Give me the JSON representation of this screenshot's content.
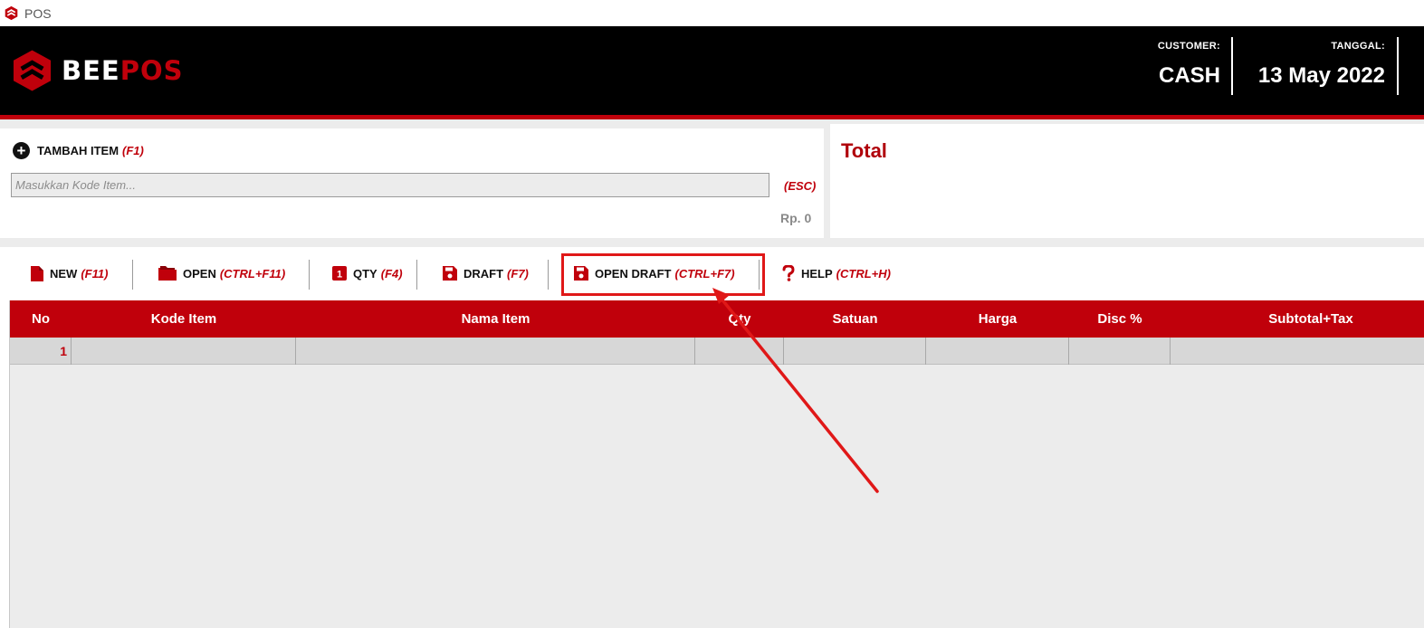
{
  "window": {
    "title": "POS"
  },
  "brand": {
    "bee": "BEE",
    "pos": "POS"
  },
  "header": {
    "customer_label": "CUSTOMER:",
    "customer_value": "CASH",
    "date_label": "TANGGAL:",
    "date_value": "13 May 2022"
  },
  "add_item": {
    "label": "TAMBAH ITEM",
    "shortcut": "(F1)",
    "placeholder": "Masukkan Kode Item...",
    "esc_shortcut": "(ESC)",
    "amount": "Rp. 0"
  },
  "total": {
    "label": "Total"
  },
  "toolbar": {
    "buttons": [
      {
        "label": "NEW",
        "shortcut": "(F11)",
        "icon": "file-icon"
      },
      {
        "label": "OPEN",
        "shortcut": "(CTRL+F11)",
        "icon": "folder-icon"
      },
      {
        "label": "QTY",
        "shortcut": "(F4)",
        "icon": "qty-icon"
      },
      {
        "label": "DRAFT",
        "shortcut": "(F7)",
        "icon": "save-icon"
      },
      {
        "label": "OPEN DRAFT",
        "shortcut": "(CTRL+F7)",
        "icon": "save-icon"
      },
      {
        "label": "HELP",
        "shortcut": "(CTRL+H)",
        "icon": "question-icon"
      }
    ]
  },
  "grid": {
    "columns": [
      "No",
      "Kode Item",
      "Nama Item",
      "Qty",
      "Satuan",
      "Harga",
      "Disc %",
      "Subtotal+Tax"
    ],
    "rows": [
      {
        "no": "1",
        "kode": "",
        "nama": "",
        "qty": "",
        "satuan": "",
        "harga": "",
        "disc": "",
        "subtotal": ""
      }
    ]
  },
  "colors": {
    "brand_red": "#c0000b",
    "highlight_red": "#e01818",
    "header_bg": "#000000"
  },
  "annotation": {
    "type": "arrow",
    "color": "#e01818",
    "points_to": "OPEN DRAFT (CTRL+F7)"
  }
}
